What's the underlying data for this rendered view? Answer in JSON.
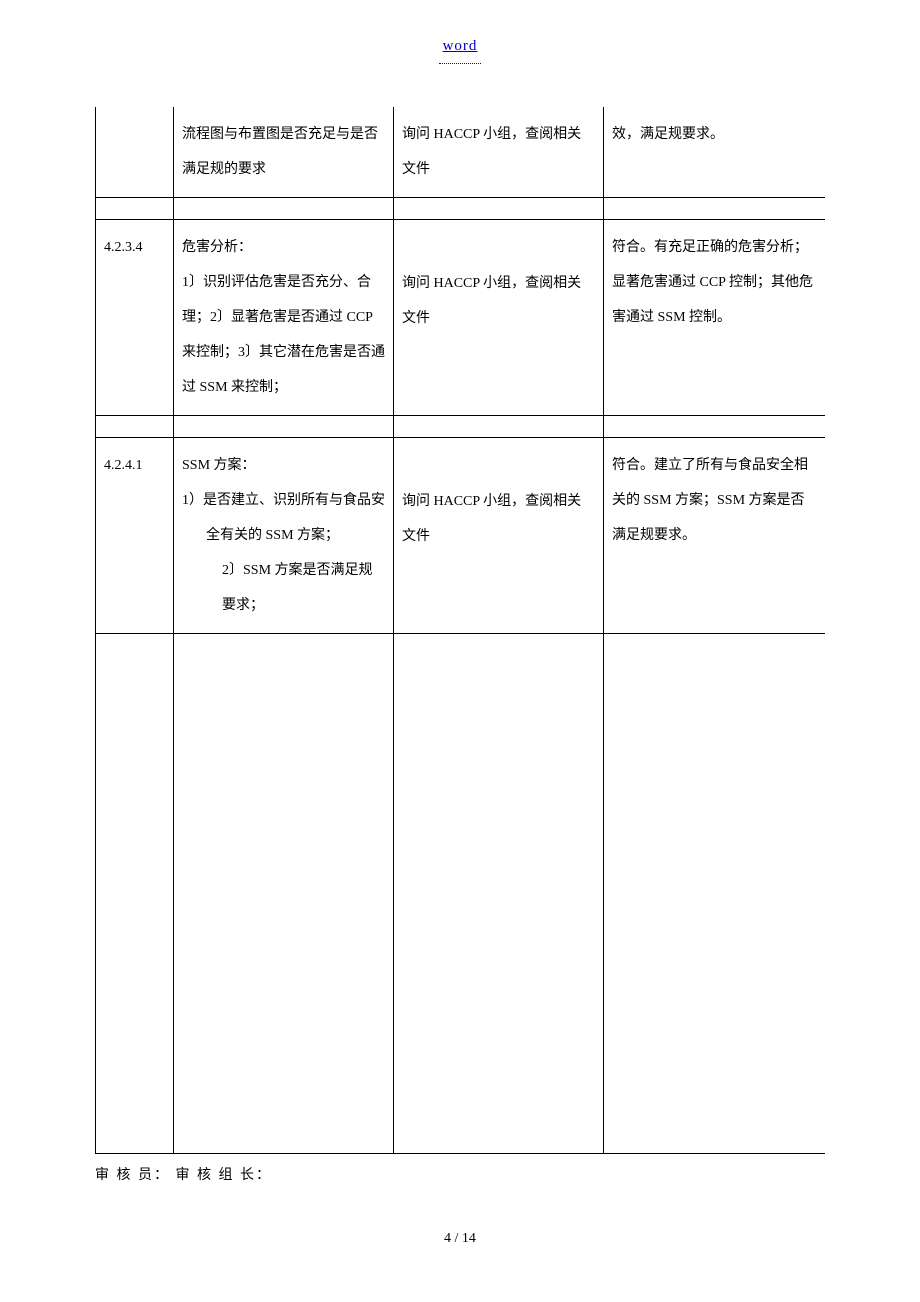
{
  "header": {
    "title": "word"
  },
  "rows": [
    {
      "num": "",
      "item": "流程图与布置图是否充足与是否满足规的要求",
      "method": "询问 HACCP 小组，查阅相关文件",
      "result": "效，满足规要求。"
    },
    {
      "num": "4.2.3.4",
      "item_title": "危害分析：",
      "item_body": "1〕识别评估危害是否充分、合理；2〕显著危害是否通过 CCP 来控制；3〕其它潜在危害是否通过 SSM 来控制；",
      "method": "询问 HACCP 小组，查阅相关文件",
      "result": "符合。有充足正确的危害分析；显著危害通过 CCP 控制；其他危害通过 SSM 控制。"
    },
    {
      "num": "4.2.4.1",
      "item_title": "SSM 方案：",
      "item_body1": "1）是否建立、识别所有与食品安全有关的 SSM 方案；",
      "item_body2": "2〕SSM 方案是否满足规要求；",
      "method": "询问 HACCP 小组，查阅相关文件",
      "result": "符合。建立了所有与食品安全相关的 SSM 方案；SSM 方案是否满足规要求。"
    }
  ],
  "signatures": {
    "auditor_label": "审 核 员：",
    "leader_label": "审 核 组 长："
  },
  "footer": {
    "page": "4 / 14"
  }
}
